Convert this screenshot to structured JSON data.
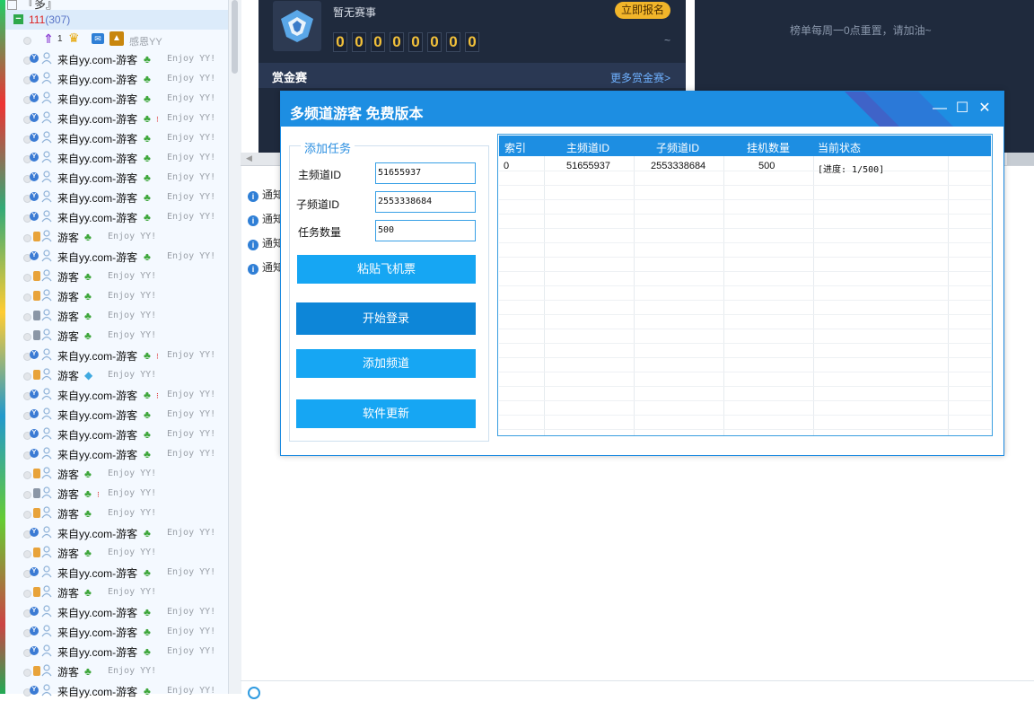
{
  "left_list": {
    "top_group": "『多』",
    "channel": {
      "name": "111",
      "count": "(307)"
    },
    "vip": {
      "level": "1",
      "nick": "感恩YY"
    },
    "members": [
      {
        "nick": "来自yy.com-游客",
        "kind": "web",
        "flag": false,
        "gem": false
      },
      {
        "nick": "来自yy.com-游客",
        "kind": "web",
        "flag": false,
        "gem": false
      },
      {
        "nick": "来自yy.com-游客",
        "kind": "web",
        "flag": false,
        "gem": false
      },
      {
        "nick": "来自yy.com-游客",
        "kind": "web",
        "flag": true,
        "gem": false
      },
      {
        "nick": "来自yy.com-游客",
        "kind": "web",
        "flag": false,
        "gem": false
      },
      {
        "nick": "来自yy.com-游客",
        "kind": "web",
        "flag": false,
        "gem": false
      },
      {
        "nick": "来自yy.com-游客",
        "kind": "web",
        "flag": false,
        "gem": false
      },
      {
        "nick": "来自yy.com-游客",
        "kind": "web",
        "flag": false,
        "gem": false
      },
      {
        "nick": "来自yy.com-游客",
        "kind": "web",
        "flag": false,
        "gem": false
      },
      {
        "nick": "游客",
        "kind": "phone",
        "flag": false,
        "gem": false
      },
      {
        "nick": "来自yy.com-游客",
        "kind": "web",
        "flag": false,
        "gem": false
      },
      {
        "nick": "游客",
        "kind": "phone",
        "flag": false,
        "gem": false
      },
      {
        "nick": "游客",
        "kind": "phone",
        "flag": false,
        "gem": false
      },
      {
        "nick": "游客",
        "kind": "phone-gray",
        "flag": false,
        "gem": false
      },
      {
        "nick": "游客",
        "kind": "phone-gray",
        "flag": false,
        "gem": false
      },
      {
        "nick": "来自yy.com-游客",
        "kind": "web",
        "flag": true,
        "gem": false
      },
      {
        "nick": "游客",
        "kind": "phone",
        "flag": false,
        "gem": true
      },
      {
        "nick": "来自yy.com-游客",
        "kind": "web",
        "flag": true,
        "gem": false
      },
      {
        "nick": "来自yy.com-游客",
        "kind": "web",
        "flag": false,
        "gem": false
      },
      {
        "nick": "来自yy.com-游客",
        "kind": "web",
        "flag": false,
        "gem": false
      },
      {
        "nick": "来自yy.com-游客",
        "kind": "web",
        "flag": false,
        "gem": false
      },
      {
        "nick": "游客",
        "kind": "phone",
        "flag": false,
        "gem": false
      },
      {
        "nick": "游客",
        "kind": "phone-gray",
        "flag": true,
        "gem": false
      },
      {
        "nick": "游客",
        "kind": "phone",
        "flag": false,
        "gem": false
      },
      {
        "nick": "来自yy.com-游客",
        "kind": "web",
        "flag": false,
        "gem": false
      },
      {
        "nick": "游客",
        "kind": "phone",
        "flag": false,
        "gem": false
      },
      {
        "nick": "来自yy.com-游客",
        "kind": "web",
        "flag": false,
        "gem": false
      },
      {
        "nick": "游客",
        "kind": "phone",
        "flag": false,
        "gem": false
      },
      {
        "nick": "来自yy.com-游客",
        "kind": "web",
        "flag": false,
        "gem": false
      },
      {
        "nick": "来自yy.com-游客",
        "kind": "web",
        "flag": false,
        "gem": false
      },
      {
        "nick": "来自yy.com-游客",
        "kind": "web",
        "flag": false,
        "gem": false
      },
      {
        "nick": "游客",
        "kind": "phone",
        "flag": false,
        "gem": false
      },
      {
        "nick": "来自yy.com-游客",
        "kind": "web",
        "flag": false,
        "gem": false
      }
    ],
    "enjoy_text": "Enjoy YY!"
  },
  "background": {
    "no_match": "暂无赛事",
    "signup": "立即报名",
    "digits": [
      "0",
      "0",
      "0",
      "0",
      "0",
      "0",
      "0",
      "0"
    ],
    "tilde": "~",
    "rank_reset": "榜单每周一0点重置，请加油~",
    "bounty_title": "赏金赛",
    "more_bounty": "更多赏金赛>",
    "notice_label": "通知",
    "notice_count": 4
  },
  "dialog": {
    "title": "多频道游客 免费版本",
    "minimize": "—",
    "maximize": "☐",
    "close": "✕",
    "group_title": "添加任务",
    "fields": {
      "main_id": {
        "label": "主频道ID",
        "value": "51655937"
      },
      "sub_id": {
        "label": "子频道ID",
        "value": "2553338684"
      },
      "count": {
        "label": "任务数量",
        "value": "500"
      }
    },
    "buttons": {
      "paste": "粘贴飞机票",
      "login": "开始登录",
      "add_channel": "添加频道",
      "update": "软件更新"
    },
    "table": {
      "columns": [
        "索引",
        "主频道ID",
        "子频道ID",
        "挂机数量",
        "当前状态"
      ],
      "rows": [
        {
          "index": "0",
          "main": "51655937",
          "sub": "2553338684",
          "count": "500",
          "status": "[进度: 1/500]"
        }
      ]
    }
  },
  "colors": {
    "accent": "#1d8ee2",
    "button": "#16a6f3",
    "button_active": "#0d86d8",
    "dark_bg": "#1f2a3d"
  }
}
